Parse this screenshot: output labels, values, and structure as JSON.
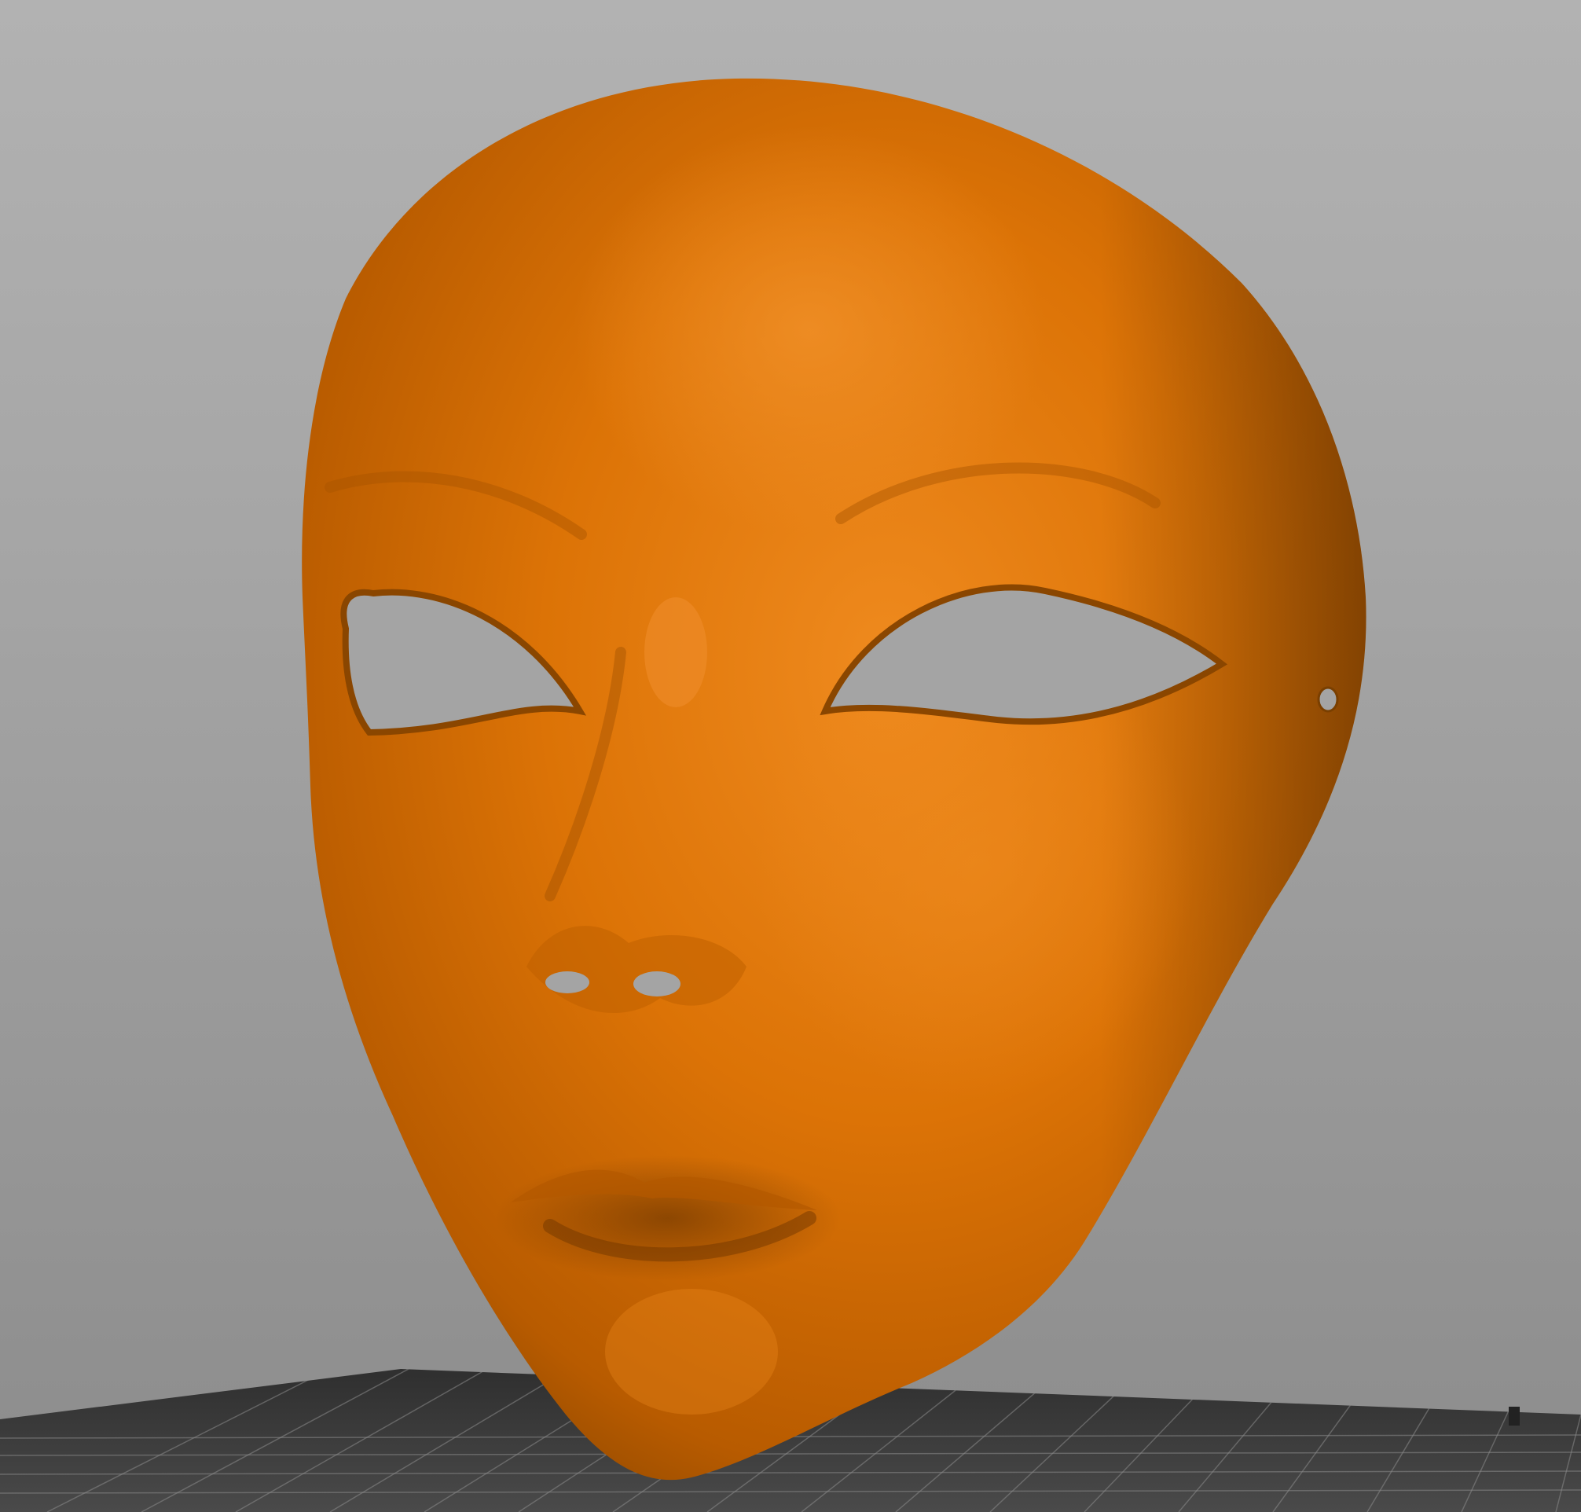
{
  "app": {
    "view": "3d-viewport"
  },
  "colors": {
    "background_top": "#b2b2b2",
    "background_bottom": "#8c8c8c",
    "model_base": "#d66e00",
    "model_highlight": "#ee8a1e",
    "model_shadow": "#7a3f00",
    "bed_plate": "#3a3a3a",
    "bed_grid": "#8a8a8a"
  },
  "scene": {
    "model": {
      "object": "face-mask",
      "features": [
        "eye-cutout-left",
        "eye-cutout-right",
        "nostril-holes",
        "strap-hole-right"
      ]
    },
    "bed": {
      "grid": true
    }
  }
}
